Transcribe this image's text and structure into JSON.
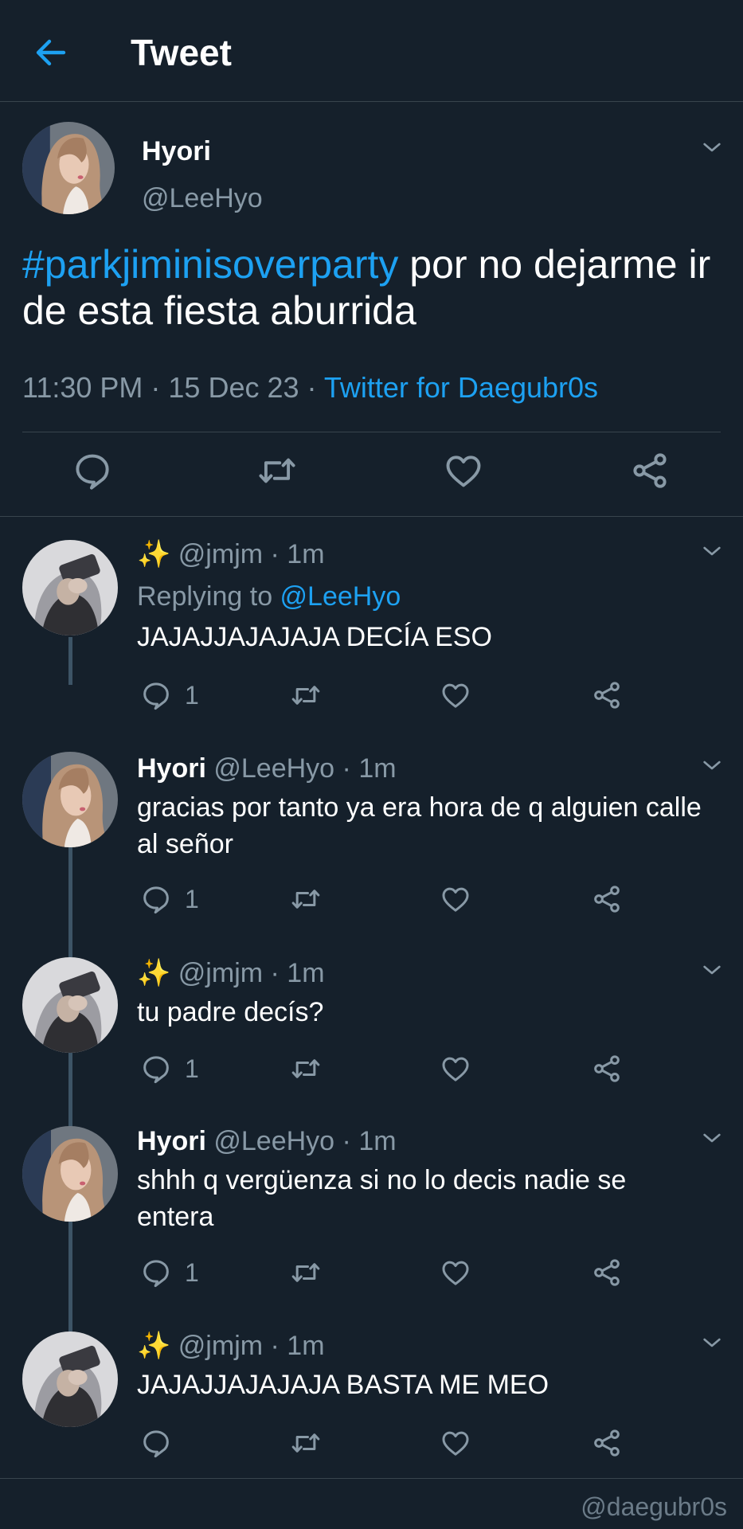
{
  "header": {
    "title": "Tweet"
  },
  "main_tweet": {
    "name": "Hyori",
    "handle": "@LeeHyo",
    "hashtag": "#parkjiminisoverparty",
    "text": " por no dejarme ir de esta fiesta aburrida",
    "time": "11:30 PM · 15 Dec 23 · ",
    "source": "Twitter for Daegubr0s"
  },
  "replies": [
    {
      "emoji": "✨",
      "name": "",
      "handle": "@jmjm",
      "time": "· 1m",
      "replying_label": "Replying to ",
      "replying_to": "@LeeHyo",
      "text": "JAJAJJAJAJAJA DECÍA ESO",
      "reply_count": "1"
    },
    {
      "emoji": "",
      "name": "Hyori",
      "handle": "@LeeHyo",
      "time": "· 1m",
      "text": "gracias por tanto ya era hora de q alguien calle al señor",
      "reply_count": "1"
    },
    {
      "emoji": "✨",
      "name": "",
      "handle": "@jmjm",
      "time": "· 1m",
      "text": "tu padre decís?",
      "reply_count": "1"
    },
    {
      "emoji": "",
      "name": "Hyori",
      "handle": "@LeeHyo",
      "time": "· 1m",
      "text": "shhh q vergüenza si no lo decis nadie se entera",
      "reply_count": "1"
    },
    {
      "emoji": "✨",
      "name": "",
      "handle": "@jmjm",
      "time": "· 1m",
      "text": "JAJAJJAJAJAJA BASTA ME MEO",
      "reply_count": ""
    }
  ],
  "watermark": "@daegubr0s",
  "colors": {
    "background": "#15202b",
    "accent": "#1da1f2",
    "secondary_text": "#8899a6",
    "divider": "#38444d"
  },
  "icons": [
    "back-arrow-icon",
    "chevron-down-icon",
    "comment-icon",
    "retweet-icon",
    "heart-icon",
    "share-icon"
  ]
}
